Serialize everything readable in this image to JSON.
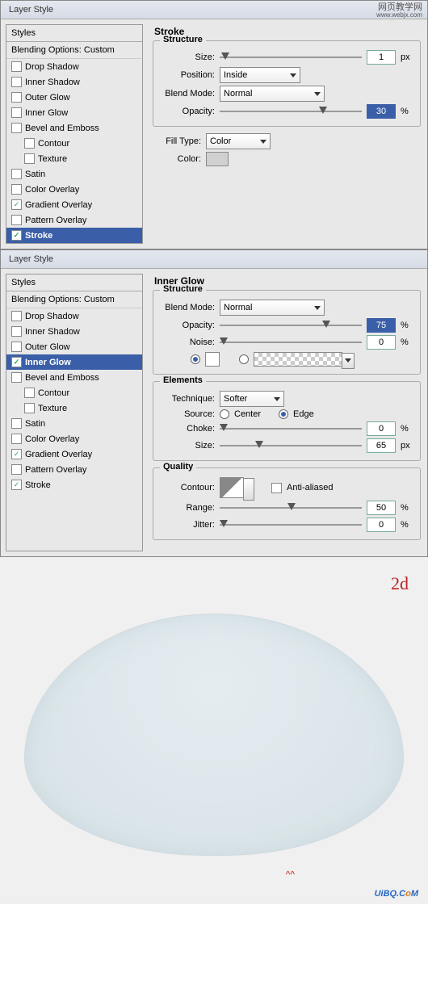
{
  "watermark": {
    "line1": "网页教学网",
    "line2": "www.webjx.com"
  },
  "panel1": {
    "title": "Layer Style",
    "styles_header": "Styles",
    "blending": "Blending Options: Custom",
    "items": [
      {
        "label": "Drop Shadow",
        "checked": false,
        "selected": false
      },
      {
        "label": "Inner Shadow",
        "checked": false,
        "selected": false
      },
      {
        "label": "Outer Glow",
        "checked": false,
        "selected": false
      },
      {
        "label": "Inner Glow",
        "checked": false,
        "selected": false
      },
      {
        "label": "Bevel and Emboss",
        "checked": false,
        "selected": false
      },
      {
        "label": "Contour",
        "checked": false,
        "selected": false,
        "indent": true
      },
      {
        "label": "Texture",
        "checked": false,
        "selected": false,
        "indent": true
      },
      {
        "label": "Satin",
        "checked": false,
        "selected": false
      },
      {
        "label": "Color Overlay",
        "checked": false,
        "selected": false
      },
      {
        "label": "Gradient Overlay",
        "checked": true,
        "selected": false
      },
      {
        "label": "Pattern Overlay",
        "checked": false,
        "selected": false
      },
      {
        "label": "Stroke",
        "checked": true,
        "selected": true
      }
    ],
    "section": "Stroke",
    "structure": {
      "legend": "Structure",
      "size_label": "Size:",
      "size_value": "1",
      "size_unit": "px",
      "position_label": "Position:",
      "position_value": "Inside",
      "blend_label": "Blend Mode:",
      "blend_value": "Normal",
      "opacity_label": "Opacity:",
      "opacity_value": "30",
      "opacity_unit": "%"
    },
    "fill": {
      "fill_type_label": "Fill Type:",
      "fill_type_value": "Color",
      "color_label": "Color:"
    }
  },
  "panel2": {
    "title": "Layer Style",
    "styles_header": "Styles",
    "blending": "Blending Options: Custom",
    "items": [
      {
        "label": "Drop Shadow",
        "checked": false,
        "selected": false
      },
      {
        "label": "Inner Shadow",
        "checked": false,
        "selected": false
      },
      {
        "label": "Outer Glow",
        "checked": false,
        "selected": false
      },
      {
        "label": "Inner Glow",
        "checked": true,
        "selected": true
      },
      {
        "label": "Bevel and Emboss",
        "checked": false,
        "selected": false
      },
      {
        "label": "Contour",
        "checked": false,
        "selected": false,
        "indent": true
      },
      {
        "label": "Texture",
        "checked": false,
        "selected": false,
        "indent": true
      },
      {
        "label": "Satin",
        "checked": false,
        "selected": false
      },
      {
        "label": "Color Overlay",
        "checked": false,
        "selected": false
      },
      {
        "label": "Gradient Overlay",
        "checked": true,
        "selected": false
      },
      {
        "label": "Pattern Overlay",
        "checked": false,
        "selected": false
      },
      {
        "label": "Stroke",
        "checked": true,
        "selected": false
      }
    ],
    "section": "Inner Glow",
    "structure": {
      "legend": "Structure",
      "blend_label": "Blend Mode:",
      "blend_value": "Normal",
      "opacity_label": "Opacity:",
      "opacity_value": "75",
      "opacity_unit": "%",
      "noise_label": "Noise:",
      "noise_value": "0",
      "noise_unit": "%"
    },
    "elements": {
      "legend": "Elements",
      "technique_label": "Technique:",
      "technique_value": "Softer",
      "source_label": "Source:",
      "center_label": "Center",
      "edge_label": "Edge",
      "choke_label": "Choke:",
      "choke_value": "0",
      "choke_unit": "%",
      "size_label": "Size:",
      "size_value": "65",
      "size_unit": "px"
    },
    "quality": {
      "legend": "Quality",
      "contour_label": "Contour:",
      "aa_label": "Anti-aliased",
      "range_label": "Range:",
      "range_value": "50",
      "range_unit": "%",
      "jitter_label": "Jitter:",
      "jitter_value": "0",
      "jitter_unit": "%"
    }
  },
  "preview": {
    "step": "2d",
    "logo_text": "UiBQ.C",
    "logo_suffix": "o",
    "logo_end": "M"
  }
}
